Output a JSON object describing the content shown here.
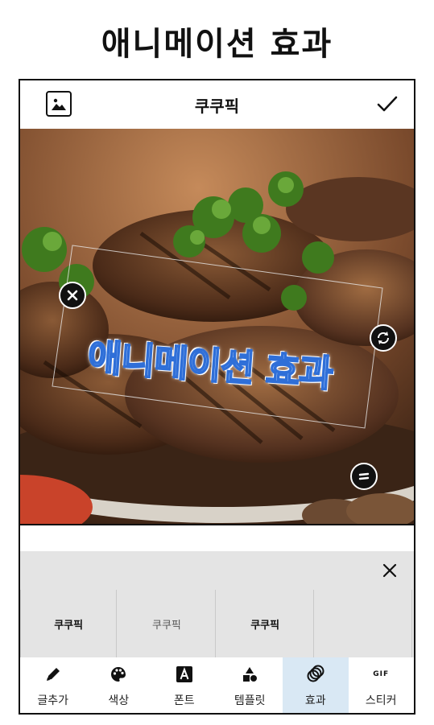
{
  "banner": {
    "title": "애니메이션 효과"
  },
  "topbar": {
    "title": "쿠쿠픽"
  },
  "canvas": {
    "effect_text": "애니메이션 효과"
  },
  "presets": [
    {
      "label": "쿠쿠픽"
    },
    {
      "label": "쿠쿠픽"
    },
    {
      "label": "쿠쿠픽"
    },
    {
      "label": ""
    }
  ],
  "tabs": [
    {
      "label": "글추가",
      "icon": "pencil-icon"
    },
    {
      "label": "색상",
      "icon": "palette-icon"
    },
    {
      "label": "폰트",
      "icon": "font-icon"
    },
    {
      "label": "템플릿",
      "icon": "shapes-icon"
    },
    {
      "label": "효과",
      "icon": "rings-icon",
      "active": true
    },
    {
      "label": "스티커",
      "icon": "gif-icon",
      "icon_text": "GIF"
    }
  ],
  "colors": {
    "active_tab": "#d9e8f4",
    "panel": "#e4e4e4",
    "effect_fill": "#cfe4ff",
    "effect_stroke": "#2f6fd8"
  }
}
